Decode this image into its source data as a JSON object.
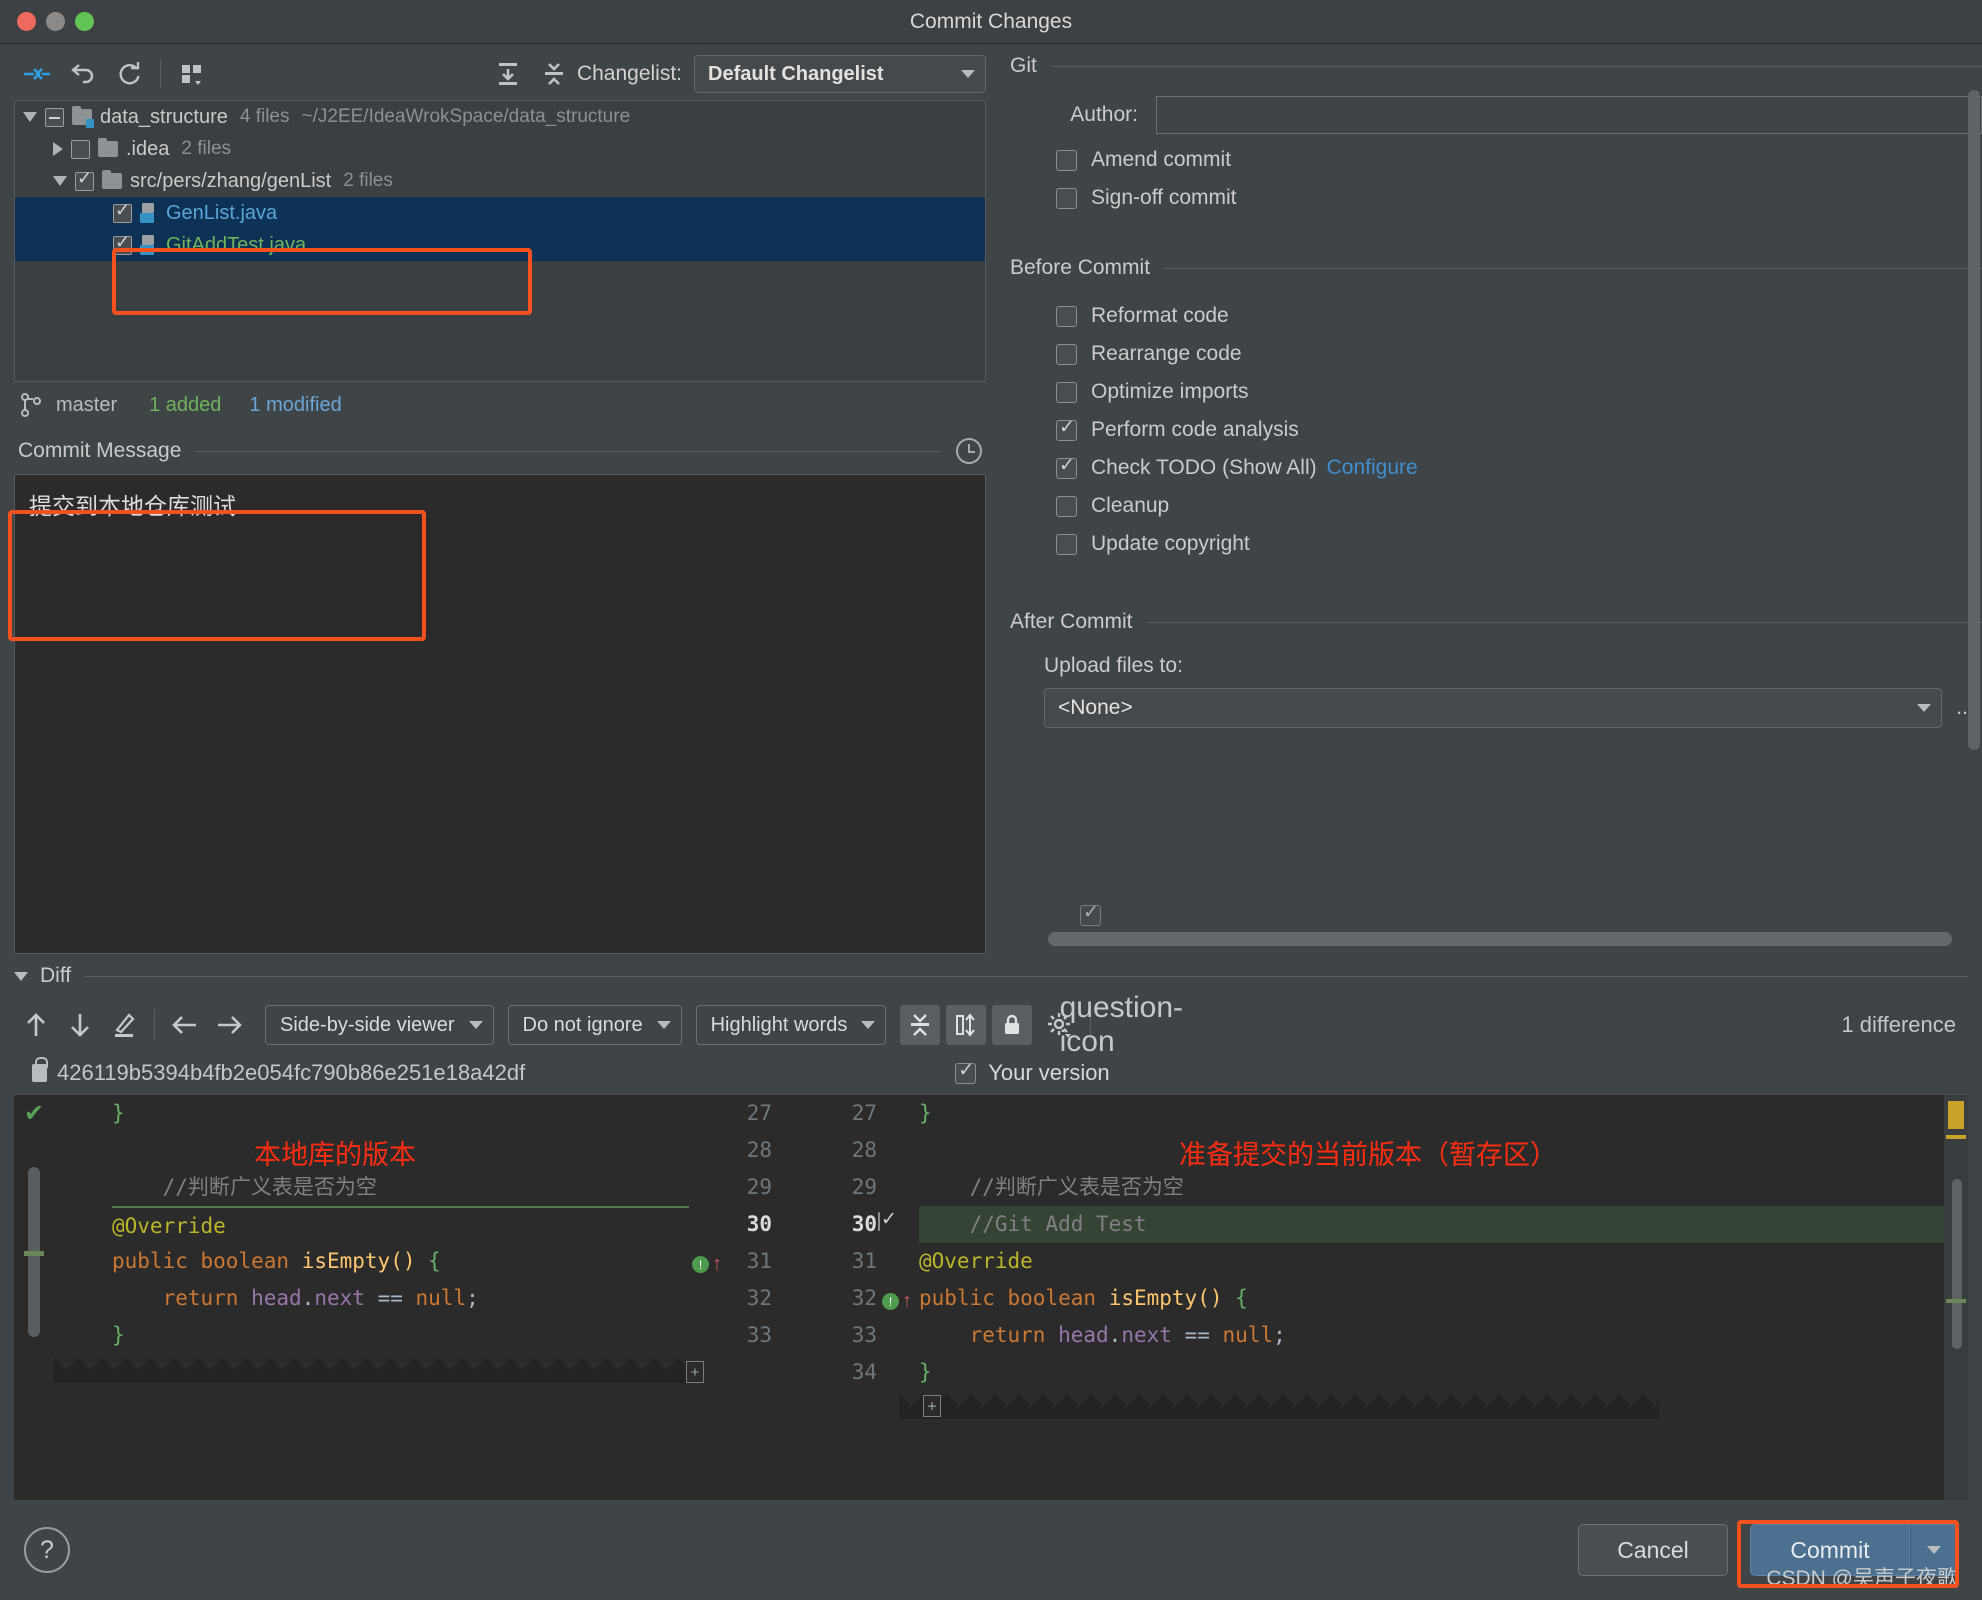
{
  "window": {
    "title": "Commit Changes",
    "traffic_lights": [
      "close",
      "minimize",
      "maximize"
    ]
  },
  "toolbar": {
    "icons": [
      "collapse-arrows-icon",
      "rollback-icon",
      "refresh-icon",
      "group-by-icon"
    ],
    "expand_all_icon": "expand-all-icon",
    "collapse_all_icon": "collapse-all-icon",
    "changelist_label": "Changelist:",
    "changelist_value": "Default Changelist"
  },
  "file_tree": {
    "rows": [
      {
        "name": "data_structure",
        "files": "4 files",
        "path": "~/J2EE/IdeaWrokSpace/data_structure",
        "indent": 0,
        "expanded": true,
        "checkbox": "partial",
        "type": "folder"
      },
      {
        "name": ".idea",
        "files": "2 files",
        "path": "",
        "indent": 1,
        "expanded": false,
        "checkbox": "unchecked",
        "type": "folder"
      },
      {
        "name": "src/pers/zhang/genList",
        "files": "2 files",
        "path": "",
        "indent": 1,
        "expanded": true,
        "checkbox": "checked",
        "type": "folder"
      },
      {
        "name": "GenList.java",
        "files": "",
        "path": "",
        "indent": 2,
        "expanded": null,
        "checkbox": "checked",
        "type": "java",
        "color": "blue",
        "selected": true
      },
      {
        "name": "GitAddTest.java",
        "files": "",
        "path": "",
        "indent": 2,
        "expanded": null,
        "checkbox": "checked",
        "type": "java",
        "color": "green",
        "selected": true
      }
    ]
  },
  "branch_status": {
    "branch_icon": "git-branch-icon",
    "branch": "master",
    "added": "1 added",
    "modified": "1 modified"
  },
  "commit_message": {
    "label": "Commit Message",
    "history_icon": "clock-history-icon",
    "value": "提交到本地仓库测试"
  },
  "git_panel": {
    "group_title": "Git",
    "author_label": "Author:",
    "author_value": "",
    "options": [
      {
        "label": "Amend commit",
        "checked": false
      },
      {
        "label": "Sign-off commit",
        "checked": false
      }
    ]
  },
  "before_commit": {
    "group_title": "Before Commit",
    "options": [
      {
        "label": "Reformat code",
        "checked": false
      },
      {
        "label": "Rearrange code",
        "checked": false
      },
      {
        "label": "Optimize imports",
        "checked": false
      },
      {
        "label": "Perform code analysis",
        "checked": true
      },
      {
        "label": "Check TODO (Show All)",
        "checked": true,
        "link": "Configure"
      },
      {
        "label": "Cleanup",
        "checked": false
      },
      {
        "label": "Update copyright",
        "checked": false
      }
    ]
  },
  "after_commit": {
    "group_title": "After Commit",
    "upload_label": "Upload files to:",
    "upload_value": "<None>",
    "dots_label": "..."
  },
  "diff": {
    "section_label": "Diff",
    "toolbar": {
      "prev_icon": "arrow-up-icon",
      "next_icon": "arrow-down-icon",
      "edit_icon": "pencil-icon",
      "left_icon": "arrow-left-icon",
      "right_icon": "arrow-right-icon",
      "viewer_mode": "Side-by-side viewer",
      "ignore_mode": "Do not ignore",
      "highlight_mode": "Highlight words",
      "collapse_icon": "collapse-unchanged-icon",
      "whitespace_icon": "side-by-side-columns-icon",
      "lock_icon": "lock-icon",
      "settings_icon": "gear-icon",
      "help_icon": "question-icon",
      "difference_count": "1 difference"
    },
    "sha_lock_icon": "lock-icon",
    "sha": "426119b5394b4fb2e054fc790b86e251e18a42df",
    "your_version_label": "Your version",
    "your_version_checked": true,
    "left_annotation": "本地库的版本",
    "right_annotation": "准备提交的当前版本（暂存区）",
    "left_lines": [
      {
        "text": "    }",
        "type": "code"
      },
      {
        "text": "",
        "type": "blank"
      },
      {
        "text": "    //判断广义表是否为空",
        "type": "comment"
      },
      {
        "text": "    @Override",
        "type": "annotation"
      },
      {
        "text": "    public boolean isEmpty() {",
        "type": "code"
      },
      {
        "text": "        return head.next == null;",
        "type": "code"
      },
      {
        "text": "    }",
        "type": "code"
      }
    ],
    "right_lines": [
      {
        "num_left": "27",
        "num_right": "27",
        "text": "    }",
        "added": false
      },
      {
        "num_left": "28",
        "num_right": "28",
        "text": "",
        "added": false
      },
      {
        "num_left": "29",
        "num_right": "29",
        "text": "    //判断广义表是否为空",
        "added": false
      },
      {
        "num_left": "30",
        "num_right": "30",
        "text": "    //Git Add Test",
        "added": true,
        "accept_checked": true
      },
      {
        "num_left": "31",
        "num_right": "31",
        "text": "    @Override",
        "added": false
      },
      {
        "num_left": "32",
        "num_right": "32",
        "text": "    public boolean isEmpty() {",
        "added": false
      },
      {
        "num_left": "33",
        "num_right": "33",
        "text": "        return head.next == null;",
        "added": false
      },
      {
        "num_left": "",
        "num_right": "34",
        "text": "    }",
        "added": false
      }
    ]
  },
  "footer": {
    "help_label": "?",
    "cancel_label": "Cancel",
    "commit_label": "Commit",
    "commit_dropdown_icon": "chevron-down-icon",
    "watermark": "CSDN @吴声子夜歌"
  },
  "colors": {
    "accent_blue": "#3592c4",
    "added_green": "#6fb35c",
    "modified_blue": "#6ba5d6",
    "annotation_red": "#ff2d10",
    "highlight_box": "#f4511e",
    "primary_button": "#4c708f"
  }
}
